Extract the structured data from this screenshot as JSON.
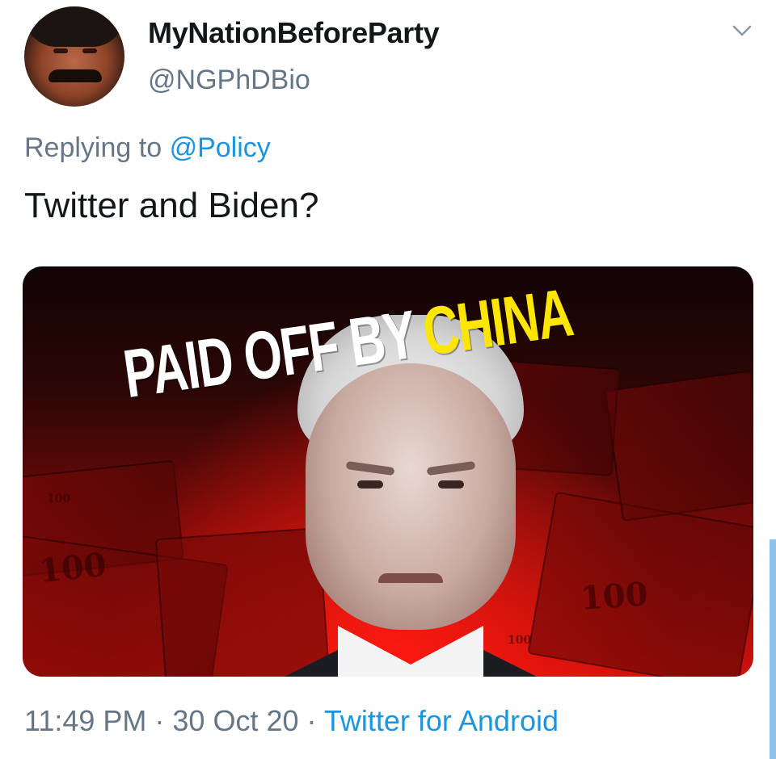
{
  "tweet": {
    "display_name": "MyNationBeforeParty",
    "handle": "@NGPhDBio",
    "replying_prefix": "Replying to",
    "replying_to": "@Policy",
    "text": "Twitter and Biden?",
    "timestamp": "11:49 PM · 30 Oct 20 · ",
    "source": "Twitter for Android"
  },
  "media": {
    "headline_white": "PAID OFF BY",
    "headline_yellow": "CHINA",
    "note_marks": [
      "100",
      "100",
      "100",
      "100"
    ]
  },
  "icons": {
    "menu": "chevron-down-icon"
  },
  "colors": {
    "link": "#1b95e0",
    "secondary": "#657786",
    "primary_text": "#14171a",
    "headline_yellow": "#ffe600"
  }
}
